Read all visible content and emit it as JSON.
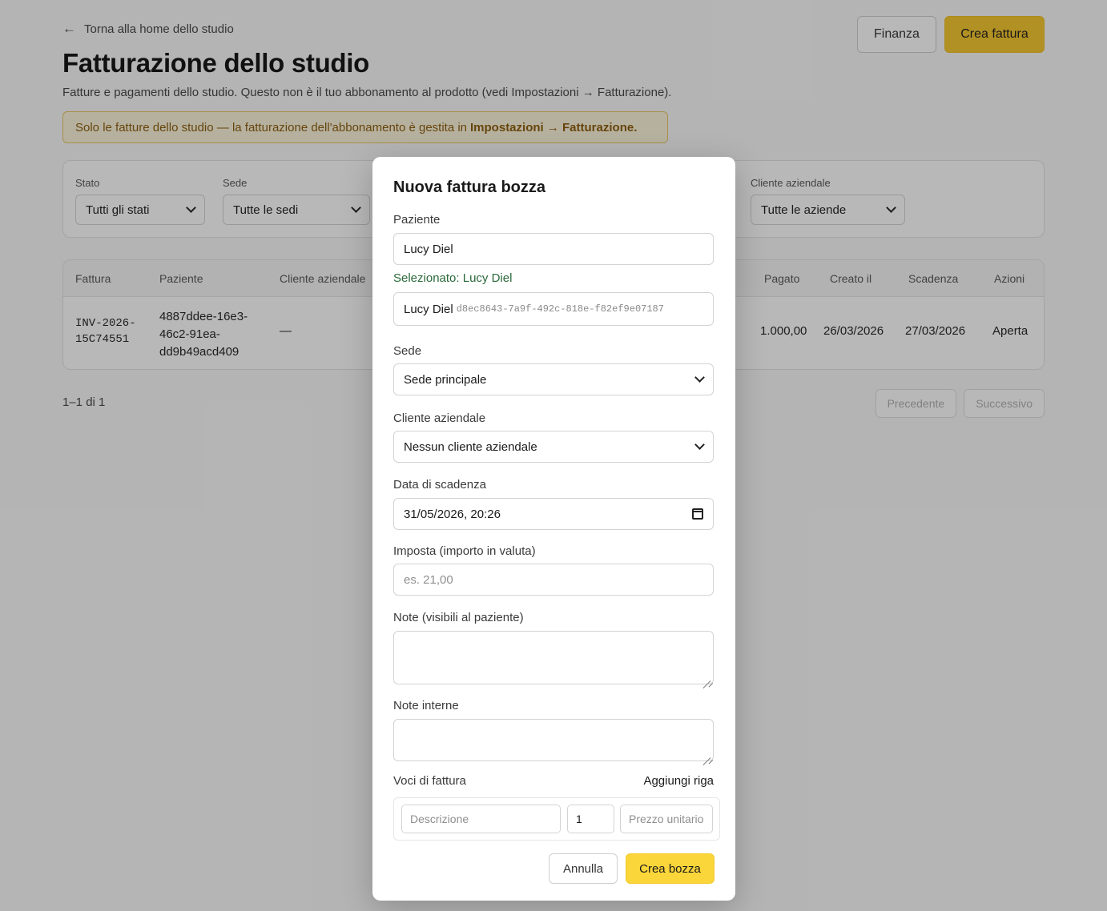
{
  "header": {
    "back_label": "Torna alla home dello studio",
    "title": "Fatturazione dello studio",
    "subtitle": "Fatture e pagamenti dello studio. Questo non è il tuo abbonamento al prodotto (vedi Impostazioni → Fatturazione).",
    "finance_label": "Finanza",
    "create_invoice_label": "Crea fattura"
  },
  "notice": {
    "prefix": "Solo le fatture dello studio — la fatturazione dell'abbonamento è gestita in",
    "link": "Impostazioni → Fatturazione."
  },
  "filters": {
    "status_label": "Stato",
    "status_value": "Tutti gli stati",
    "location_label": "Sede",
    "location_value": "Tutte le sedi",
    "company_label": "Cliente aziendale",
    "company_value": "Tutte le aziende"
  },
  "table": {
    "headers": {
      "invoice": "Fattura",
      "patient": "Paziente",
      "company": "Cliente aziendale",
      "paid": "Pagato",
      "created": "Creato il",
      "due": "Scadenza",
      "actions": "Azioni"
    },
    "rows": [
      {
        "invoice": "INV-2026-\n15C74551",
        "patient": "4887ddee-16e3-\n46c2-91ea-\ndd9b49acd409",
        "company": "—",
        "paid": "1.000,00",
        "created": "26/03/2026",
        "due": "27/03/2026",
        "action": "Aperta"
      }
    ]
  },
  "pagination": {
    "range": "1–1 di 1",
    "prev": "Precedente",
    "next": "Successivo"
  },
  "modal": {
    "title": "Nuova fattura bozza",
    "patient_label": "Paziente",
    "patient_value": "Lucy Diel",
    "selected_text": "Selezionato: Lucy Diel",
    "patient_option_name": "Lucy Diel",
    "patient_option_id": "d8ec8643-7a9f-492c-818e-f82ef9e07187",
    "location_label": "Sede",
    "location_value": "Sede principale",
    "company_label": "Cliente aziendale",
    "company_value": "Nessun cliente aziendale",
    "due_label": "Data di scadenza",
    "due_value": "31/05/2026, 20:26",
    "tax_label": "Imposta (importo in valuta)",
    "tax_placeholder": "es. 21,00",
    "notes_label": "Note (visibili al paziente)",
    "internal_notes_label": "Note interne",
    "lines_label": "Voci di fattura",
    "add_line": "Aggiungi riga",
    "line_description_placeholder": "Descrizione",
    "line_quantity": "1",
    "line_price_placeholder": "Prezzo unitario",
    "cancel_label": "Annulla",
    "create_draft_label": "Crea bozza"
  }
}
